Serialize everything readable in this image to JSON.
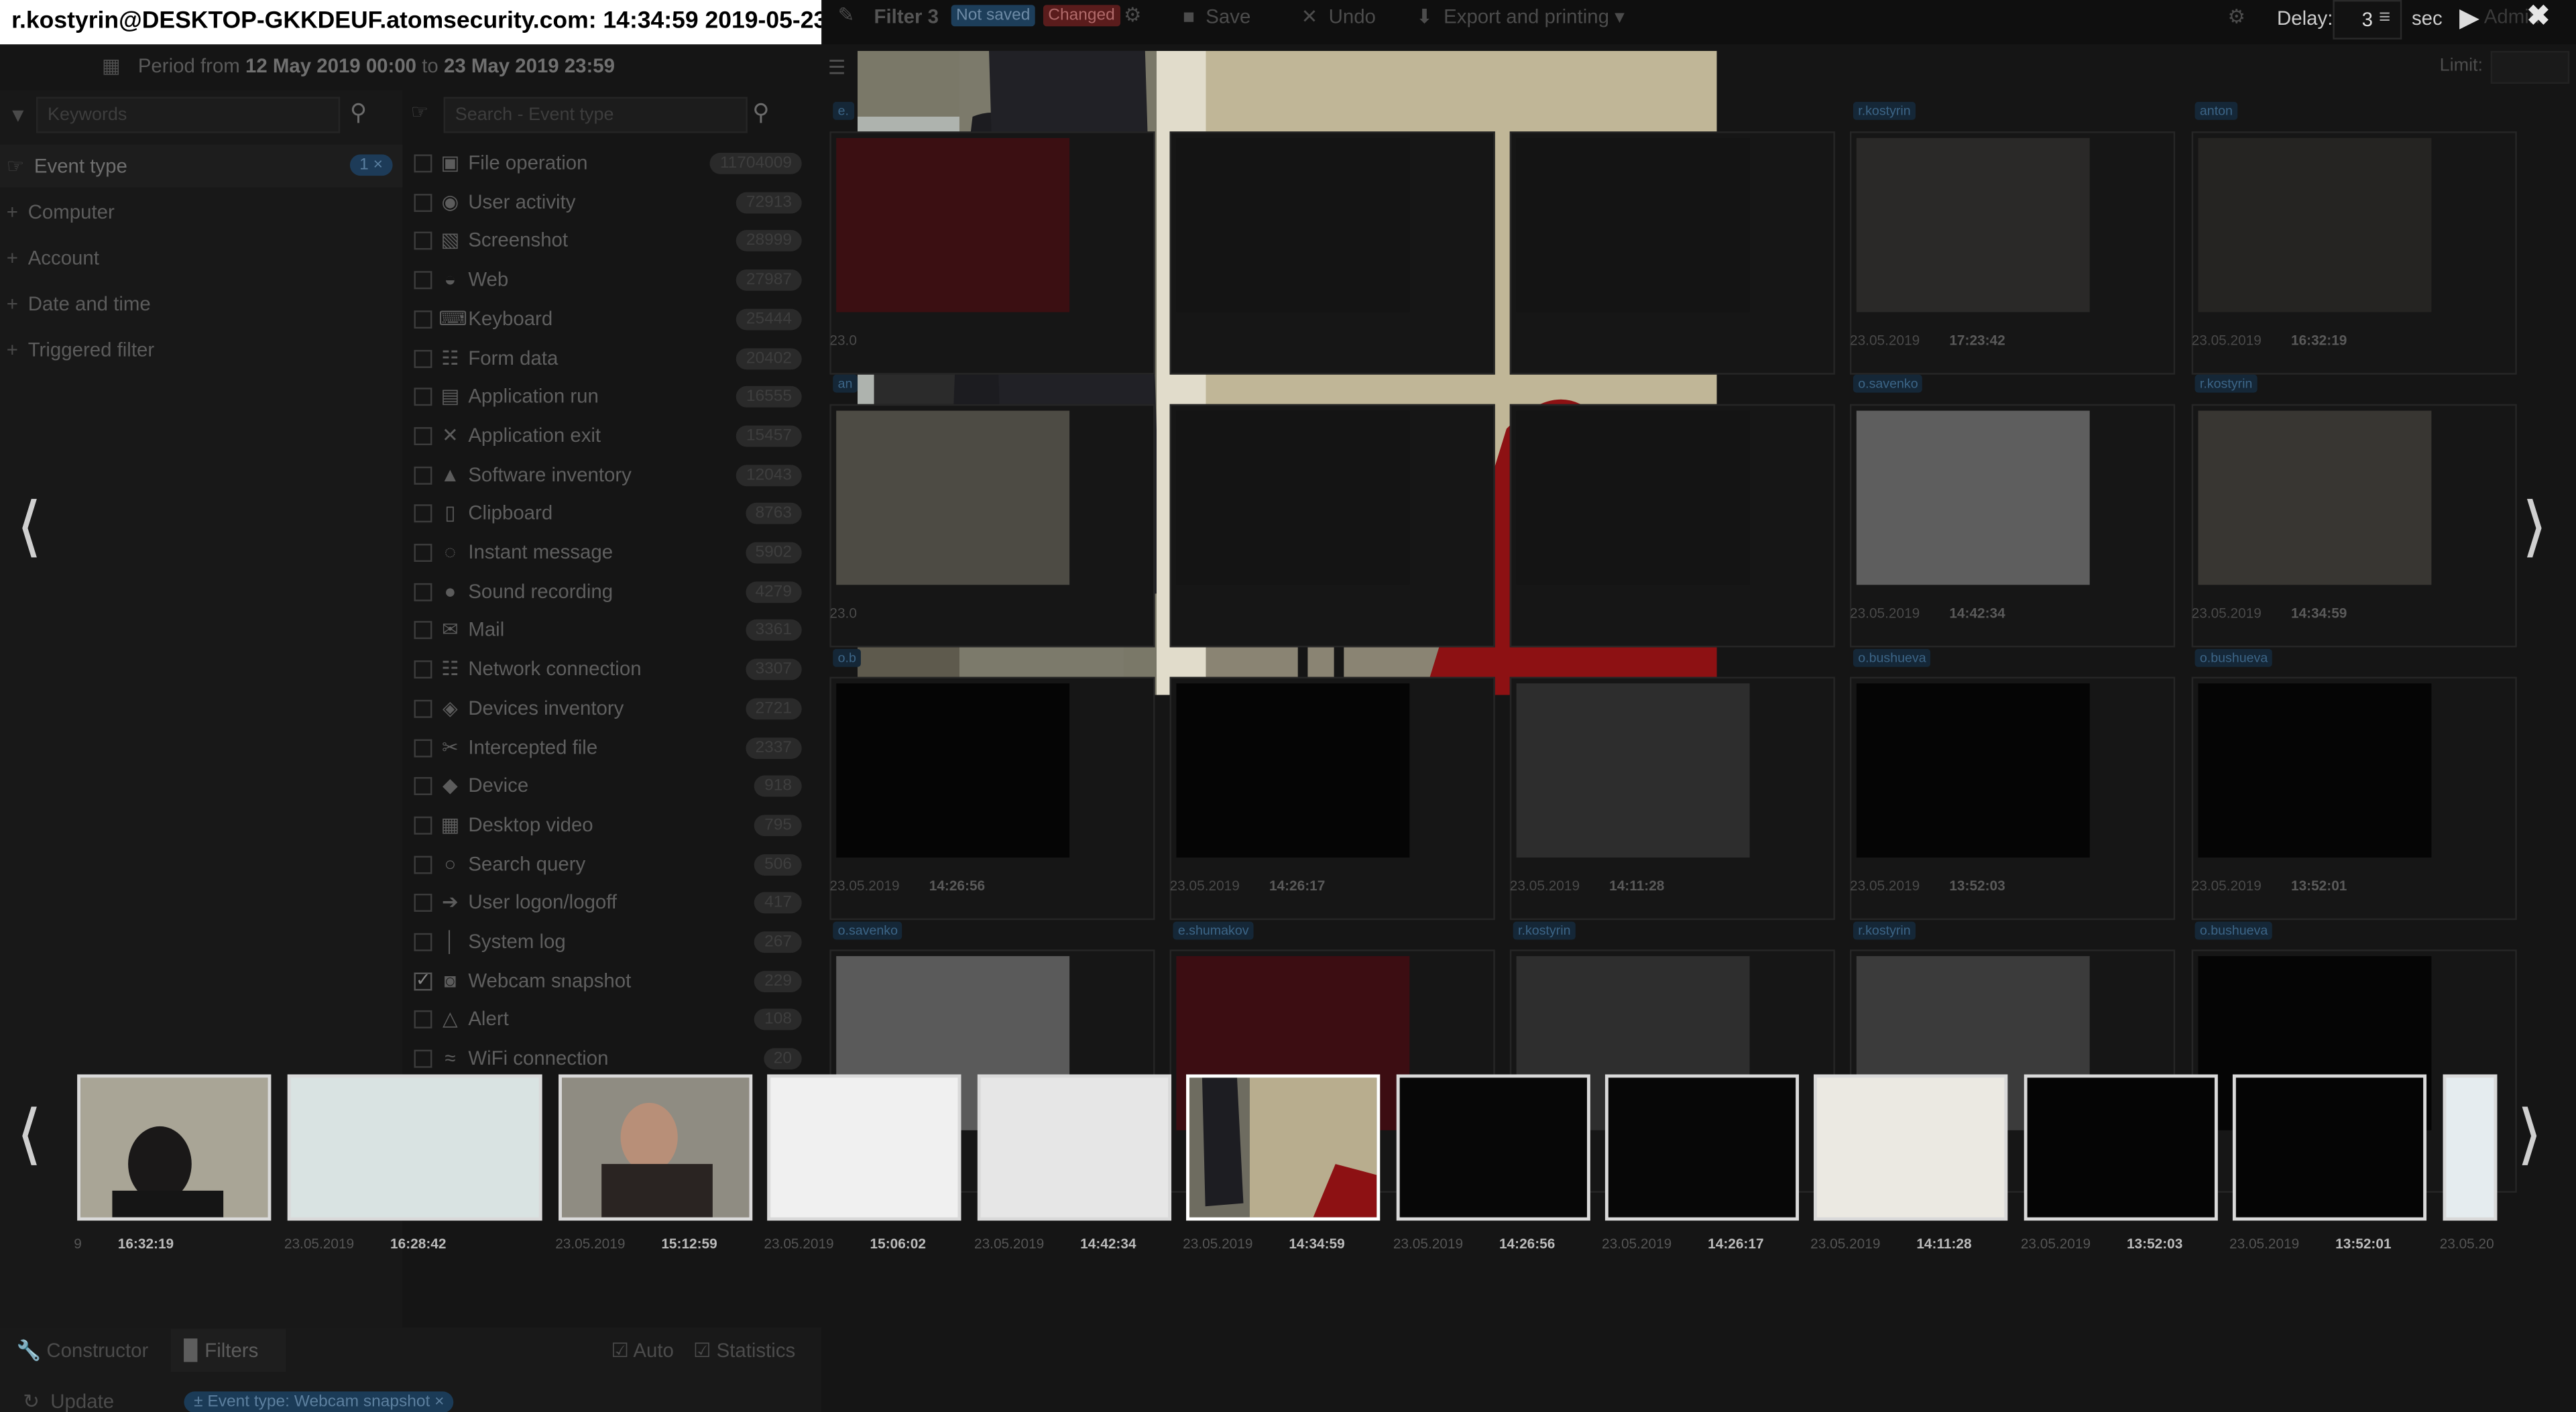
{
  "caption": "r.kostyrin@DESKTOP-GKKDEUF.atomsecurity.com: 14:34:59 2019-05-23",
  "toolbar": {
    "filter_label": "Filter 3",
    "badge_not_saved": "Not saved",
    "badge_changed": "Changed",
    "save_label": "Save",
    "undo_label": "Undo",
    "export_label": "Export and printing",
    "delay_label": "Delay:",
    "delay_value": "3",
    "sec_label": "sec",
    "user_label": "Admin"
  },
  "period": {
    "prefix": "Period from",
    "from": "12 May 2019 00:00",
    "to_word": "to",
    "to": "23 May 2019 23:59"
  },
  "limit_label": "Limit:",
  "left": {
    "keywords_placeholder": "Keywords",
    "nav": [
      {
        "label": "Event type",
        "count": "1 ×"
      },
      {
        "label": "Computer"
      },
      {
        "label": "Account"
      },
      {
        "label": "Date and time"
      },
      {
        "label": "Triggered filter"
      }
    ]
  },
  "event_search_placeholder": "Search - Event type",
  "event_types": [
    {
      "label": "File operation",
      "count": "11704009",
      "icon": "disk-icon",
      "checked": false
    },
    {
      "label": "User activity",
      "count": "72913",
      "icon": "check-circle-icon",
      "checked": false
    },
    {
      "label": "Screenshot",
      "count": "28999",
      "icon": "image-icon",
      "checked": false
    },
    {
      "label": "Web",
      "count": "27987",
      "icon": "globe-icon",
      "checked": false
    },
    {
      "label": "Keyboard",
      "count": "25444",
      "icon": "keyboard-icon",
      "checked": false
    },
    {
      "label": "Form data",
      "count": "20402",
      "icon": "form-icon",
      "checked": false
    },
    {
      "label": "Application run",
      "count": "16555",
      "icon": "app-run-icon",
      "checked": false
    },
    {
      "label": "Application exit",
      "count": "15457",
      "icon": "close-icon",
      "checked": false
    },
    {
      "label": "Software inventory",
      "count": "12043",
      "icon": "inventory-icon",
      "checked": false
    },
    {
      "label": "Clipboard",
      "count": "8763",
      "icon": "clipboard-icon",
      "checked": false
    },
    {
      "label": "Instant message",
      "count": "5902",
      "icon": "chat-icon",
      "checked": false
    },
    {
      "label": "Sound recording",
      "count": "4279",
      "icon": "microphone-icon",
      "checked": false
    },
    {
      "label": "Mail",
      "count": "3361",
      "icon": "mail-icon",
      "checked": false
    },
    {
      "label": "Network connection",
      "count": "3307",
      "icon": "network-icon",
      "checked": false
    },
    {
      "label": "Devices inventory",
      "count": "2721",
      "icon": "devices-icon",
      "checked": false
    },
    {
      "label": "Intercepted file",
      "count": "2337",
      "icon": "paperclip-icon",
      "checked": false
    },
    {
      "label": "Device",
      "count": "918",
      "icon": "device-icon",
      "checked": false
    },
    {
      "label": "Desktop video",
      "count": "795",
      "icon": "film-icon",
      "checked": false
    },
    {
      "label": "Search query",
      "count": "506",
      "icon": "search-icon",
      "checked": false
    },
    {
      "label": "User logon/logoff",
      "count": "417",
      "icon": "login-icon",
      "checked": false
    },
    {
      "label": "System log",
      "count": "267",
      "icon": "thermometer-icon",
      "checked": false
    },
    {
      "label": "Webcam snapshot",
      "count": "229",
      "icon": "camera-icon",
      "checked": true
    },
    {
      "label": "Alert",
      "count": "108",
      "icon": "bell-icon",
      "checked": false
    },
    {
      "label": "WiFi connection",
      "count": "20",
      "icon": "wifi-icon",
      "checked": false
    }
  ],
  "bottom": {
    "constructor_label": "Constructor",
    "filters_label": "Filters",
    "auto_label": "Auto",
    "statistics_label": "Statistics",
    "update_label": "Update",
    "chip_label": "± Event type: Webcam snapshot ×"
  },
  "grid": [
    {
      "tag": "e.",
      "date": "23.0",
      "time": ""
    },
    {
      "tag": "",
      "date": "",
      "time": ""
    },
    {
      "tag": "",
      "date": "",
      "time": ""
    },
    {
      "tag": "r.kostyrin",
      "date": "23.05.2019",
      "time": "17:23:42"
    },
    {
      "tag": "anton",
      "date": "23.05.2019",
      "time": "16:32:19"
    },
    {
      "tag": "an",
      "date": "23.0",
      "time": ""
    },
    {
      "tag": "",
      "date": "",
      "time": ""
    },
    {
      "tag": "",
      "date": "",
      "time": ""
    },
    {
      "tag": "o.savenko",
      "date": "23.05.2019",
      "time": "14:42:34"
    },
    {
      "tag": "r.kostyrin",
      "date": "23.05.2019",
      "time": "14:34:59"
    },
    {
      "tag": "o.b",
      "date": "23.05.2019",
      "time": "14:26:56"
    },
    {
      "tag": "",
      "date": "23.05.2019",
      "time": "14:26:17"
    },
    {
      "tag": "",
      "date": "23.05.2019",
      "time": "14:11:28"
    },
    {
      "tag": "o.bushueva",
      "date": "23.05.2019",
      "time": "13:52:03"
    },
    {
      "tag": "o.bushueva",
      "date": "23.05.2019",
      "time": "13:52:01"
    },
    {
      "tag": "o.savenko",
      "date": "",
      "time": ""
    },
    {
      "tag": "e.shumakov",
      "date": "",
      "time": ""
    },
    {
      "tag": "r.kostyrin",
      "date": "",
      "time": ""
    },
    {
      "tag": "r.kostyrin",
      "date": "",
      "time": ""
    },
    {
      "tag": "o.bushueva",
      "date": "",
      "time": ""
    }
  ],
  "filmstrip": [
    {
      "date": "9",
      "time": "16:32:19"
    },
    {
      "date": "23.05.2019",
      "time": "16:28:42"
    },
    {
      "date": "23.05.2019",
      "time": "15:12:59"
    },
    {
      "date": "23.05.2019",
      "time": "15:06:02"
    },
    {
      "date": "23.05.2019",
      "time": "14:42:34"
    },
    {
      "date": "23.05.2019",
      "time": "14:34:59"
    },
    {
      "date": "23.05.2019",
      "time": "14:26:56"
    },
    {
      "date": "23.05.2019",
      "time": "14:26:17"
    },
    {
      "date": "23.05.2019",
      "time": "14:11:28"
    },
    {
      "date": "23.05.2019",
      "time": "13:52:03"
    },
    {
      "date": "23.05.2019",
      "time": "13:52:01"
    },
    {
      "date": "23.05.20",
      "time": ""
    }
  ],
  "colors": {
    "accent": "#1d3b58",
    "changed": "#5a1c1c",
    "overlay": "#151515"
  }
}
